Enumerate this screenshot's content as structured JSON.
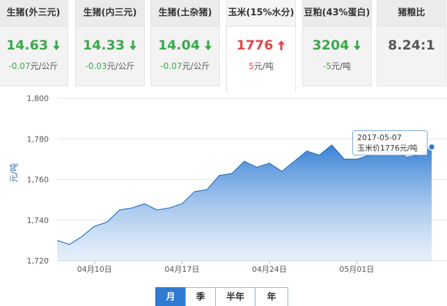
{
  "tabs": [
    {
      "title": "生猪(外三元)",
      "value": "14.63",
      "trend": "down",
      "change": "-0.07",
      "unit": "元/公斤"
    },
    {
      "title": "生猪(内三元)",
      "value": "14.33",
      "trend": "down",
      "change": "-0.03",
      "unit": "元/公斤"
    },
    {
      "title": "生猪(土杂猪)",
      "value": "14.04",
      "trend": "down",
      "change": "-0.07",
      "unit": "元/公斤"
    },
    {
      "title": "玉米(15%水分)",
      "value": "1776",
      "trend": "up",
      "change": "5",
      "unit": "元/吨"
    },
    {
      "title": "豆粕(43%蛋白)",
      "value": "3204",
      "trend": "down",
      "change": "-5",
      "unit": "元/吨"
    },
    {
      "title": "猪粮比",
      "value": "8.24:1",
      "trend": "none",
      "change": "",
      "unit": ""
    }
  ],
  "active_tab": 3,
  "colors": {
    "down": "#3aa84a",
    "up": "#e0474c",
    "area": "#2f7bd3",
    "accent": "#2f7bd3"
  },
  "tooltip": {
    "date": "2017-05-07",
    "text": "玉米价1776元/吨"
  },
  "periods": [
    {
      "label": "月",
      "active": true
    },
    {
      "label": "季",
      "active": false
    },
    {
      "label": "半年",
      "active": false
    },
    {
      "label": "年",
      "active": false
    }
  ],
  "chart_data": {
    "type": "area",
    "ylabel": "元/吨",
    "ylim": [
      1720,
      1800
    ],
    "yticks": [
      "1,720",
      "1,740",
      "1,760",
      "1,780",
      "1,800"
    ],
    "xticks": [
      "04月10日",
      "04月17日",
      "04月24日",
      "05月01日"
    ],
    "x": [
      "04-07",
      "04-08",
      "04-09",
      "04-10",
      "04-11",
      "04-12",
      "04-13",
      "04-14",
      "04-15",
      "04-16",
      "04-17",
      "04-18",
      "04-19",
      "04-20",
      "04-21",
      "04-22",
      "04-23",
      "04-24",
      "04-25",
      "04-26",
      "04-27",
      "04-28",
      "04-29",
      "04-30",
      "05-01",
      "05-02",
      "05-03",
      "05-04",
      "05-05",
      "05-06",
      "05-07"
    ],
    "series": [
      {
        "values": [
          1730,
          1728,
          1732,
          1737,
          1739,
          1745,
          1746,
          1748,
          1745,
          1746,
          1748,
          1754,
          1755,
          1762,
          1763,
          1769,
          1766,
          1768,
          1764,
          1769,
          1774,
          1772,
          1777,
          1770,
          1770,
          1772,
          1775,
          1774,
          1771,
          1772,
          1776
        ]
      }
    ],
    "grid": true,
    "legend": "none"
  }
}
